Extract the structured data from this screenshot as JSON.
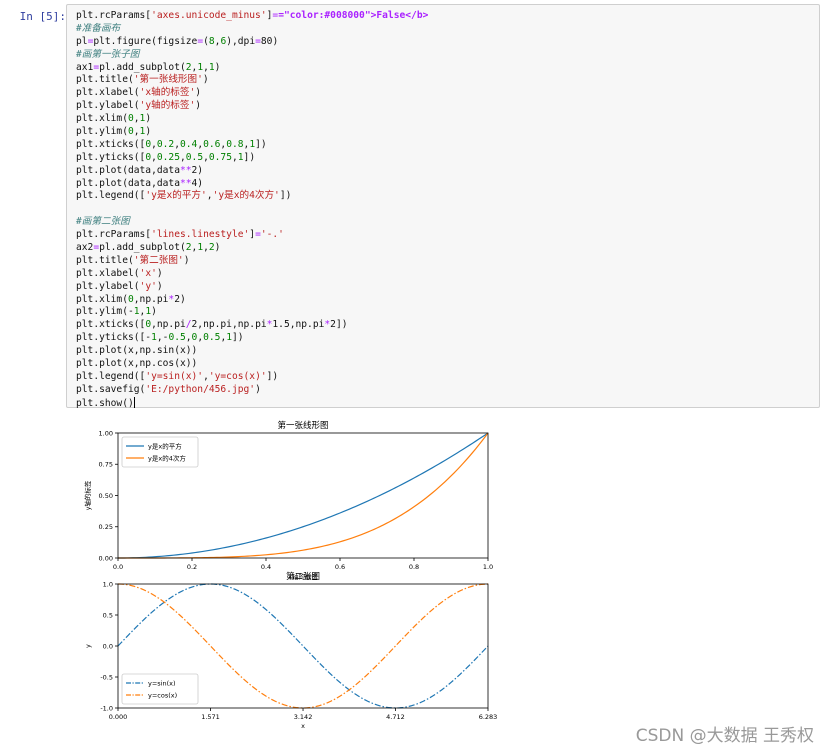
{
  "prompt": "In  [5]:",
  "code_lines": [
    "plt.rcParams['axes.unicode_minus']=False",
    "#准备画布",
    "pl=plt.figure(figsize=(8,6),dpi=80)",
    "#画第一张子图",
    "ax1=pl.add_subplot(2,1,1)",
    "plt.title('第一张线形图')",
    "plt.xlabel('x轴的标签')",
    "plt.ylabel('y轴的标签')",
    "plt.xlim(0,1)",
    "plt.ylim(0,1)",
    "plt.xticks([0,0.2,0.4,0.6,0.8,1])",
    "plt.yticks([0,0.25,0.5,0.75,1])",
    "plt.plot(data,data**2)",
    "plt.plot(data,data**4)",
    "plt.legend(['y是x的平方','y是x的4次方'])",
    "",
    "#画第二张图",
    "plt.rcParams['lines.linestyle']='-.'",
    "ax2=pl.add_subplot(2,1,2)",
    "plt.title('第二张图')",
    "plt.xlabel('x')",
    "plt.ylabel('y')",
    "plt.xlim(0,np.pi*2)",
    "plt.ylim(-1,1)",
    "plt.xticks([0,np.pi/2,np.pi,np.pi*1.5,np.pi*2])",
    "plt.yticks([-1,-0.5,0,0.5,1])",
    "plt.plot(x,np.sin(x))",
    "plt.plot(x,np.cos(x))",
    "plt.legend(['y=sin(x)','y=cos(x)'])",
    "plt.savefig('E:/python/456.jpg')",
    "plt.show()"
  ],
  "colors": {
    "keyword": "#008000",
    "string": "#ba2121",
    "comment": "#408080",
    "operator": "#aa22ff",
    "number": "#008000",
    "series_blue": "#1f77b4",
    "series_orange": "#ff7f0e"
  },
  "chart_data": [
    {
      "type": "line",
      "title": "第一张线形图",
      "xlabel": "x轴的标签",
      "ylabel": "y轴的标签",
      "xlim": [
        0,
        1
      ],
      "ylim": [
        0,
        1
      ],
      "xticks": [
        0,
        0.2,
        0.4,
        0.6,
        0.8,
        1.0
      ],
      "xtick_labels": [
        "0.0",
        "0.2",
        "0.4",
        "0.6",
        "0.8",
        "1.0"
      ],
      "yticks": [
        0,
        0.25,
        0.5,
        0.75,
        1.0
      ],
      "ytick_labels": [
        "0.00",
        "0.25",
        "0.50",
        "0.75",
        "1.00"
      ],
      "legend_position": "top-left",
      "grid": false,
      "series": [
        {
          "name": "y是x的平方",
          "color": "#1f77b4",
          "linestyle": "solid",
          "x": [
            0,
            0.1,
            0.2,
            0.3,
            0.4,
            0.5,
            0.6,
            0.7,
            0.8,
            0.9,
            1.0
          ],
          "values": [
            0,
            0.01,
            0.04,
            0.09,
            0.16,
            0.25,
            0.36,
            0.49,
            0.64,
            0.81,
            1.0
          ]
        },
        {
          "name": "y是x的4次方",
          "color": "#ff7f0e",
          "linestyle": "solid",
          "x": [
            0,
            0.1,
            0.2,
            0.3,
            0.4,
            0.5,
            0.6,
            0.7,
            0.8,
            0.9,
            1.0
          ],
          "values": [
            0,
            0.0001,
            0.0016,
            0.0081,
            0.0256,
            0.0625,
            0.1296,
            0.2401,
            0.4096,
            0.6561,
            1.0
          ]
        }
      ]
    },
    {
      "type": "line",
      "title": "第二张图",
      "xlabel": "x",
      "ylabel": "y",
      "xlim": [
        0,
        6.283
      ],
      "ylim": [
        -1,
        1
      ],
      "xticks": [
        0,
        1.571,
        3.142,
        4.712,
        6.283
      ],
      "xtick_labels": [
        "0.000",
        "1.571",
        "3.142",
        "4.712",
        "6.283"
      ],
      "yticks": [
        -1,
        -0.5,
        0,
        0.5,
        1
      ],
      "ytick_labels": [
        "-1.0",
        "-0.5",
        "0.0",
        "0.5",
        "1.0"
      ],
      "legend_position": "bottom-left",
      "grid": false,
      "series": [
        {
          "name": "y=sin(x)",
          "color": "#1f77b4",
          "linestyle": "dashdot",
          "x": [
            0,
            0.785,
            1.571,
            2.356,
            3.142,
            3.927,
            4.712,
            5.498,
            6.283
          ],
          "values": [
            0,
            0.707,
            1,
            0.707,
            0,
            -0.707,
            -1,
            -0.707,
            0
          ]
        },
        {
          "name": "y=cos(x)",
          "color": "#ff7f0e",
          "linestyle": "dashdot",
          "x": [
            0,
            0.785,
            1.571,
            2.356,
            3.142,
            3.927,
            4.712,
            5.498,
            6.283
          ],
          "values": [
            1,
            0.707,
            0,
            -0.707,
            -1,
            -0.707,
            0,
            0.707,
            1
          ]
        }
      ]
    }
  ],
  "watermark": "CSDN @大数据 王秀权"
}
